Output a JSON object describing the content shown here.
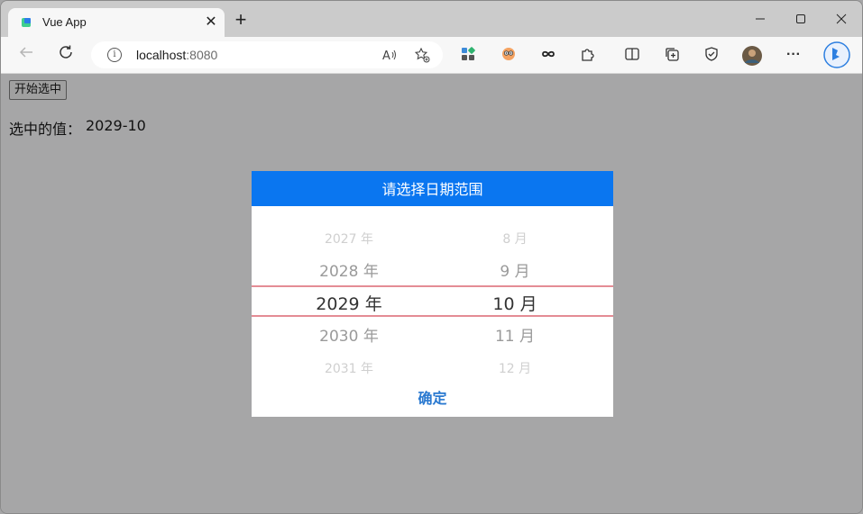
{
  "browser": {
    "tab_title": "Vue App",
    "close_glyph": "✕",
    "new_tab_glyph": "+",
    "url_host": "localhost",
    "url_port": ":8080",
    "more_glyph": "···"
  },
  "page": {
    "start_button_label": "开始选中",
    "selected_label": "选中的值：",
    "selected_value": "2029-10"
  },
  "picker": {
    "header_title": "请选择日期范围",
    "years": [
      "2027 年",
      "2028 年",
      "2029 年",
      "2030 年",
      "2031 年"
    ],
    "months": [
      "8 月",
      "9 月",
      "10 月",
      "11 月",
      "12 月"
    ],
    "selected_year_index": 2,
    "selected_month_index": 2,
    "confirm_label": "确定"
  },
  "colors": {
    "header_bg": "#0a76f0",
    "selection_line": "#e48c95",
    "confirm_text": "#2a79d0",
    "overlay": "#a6a6a7"
  }
}
